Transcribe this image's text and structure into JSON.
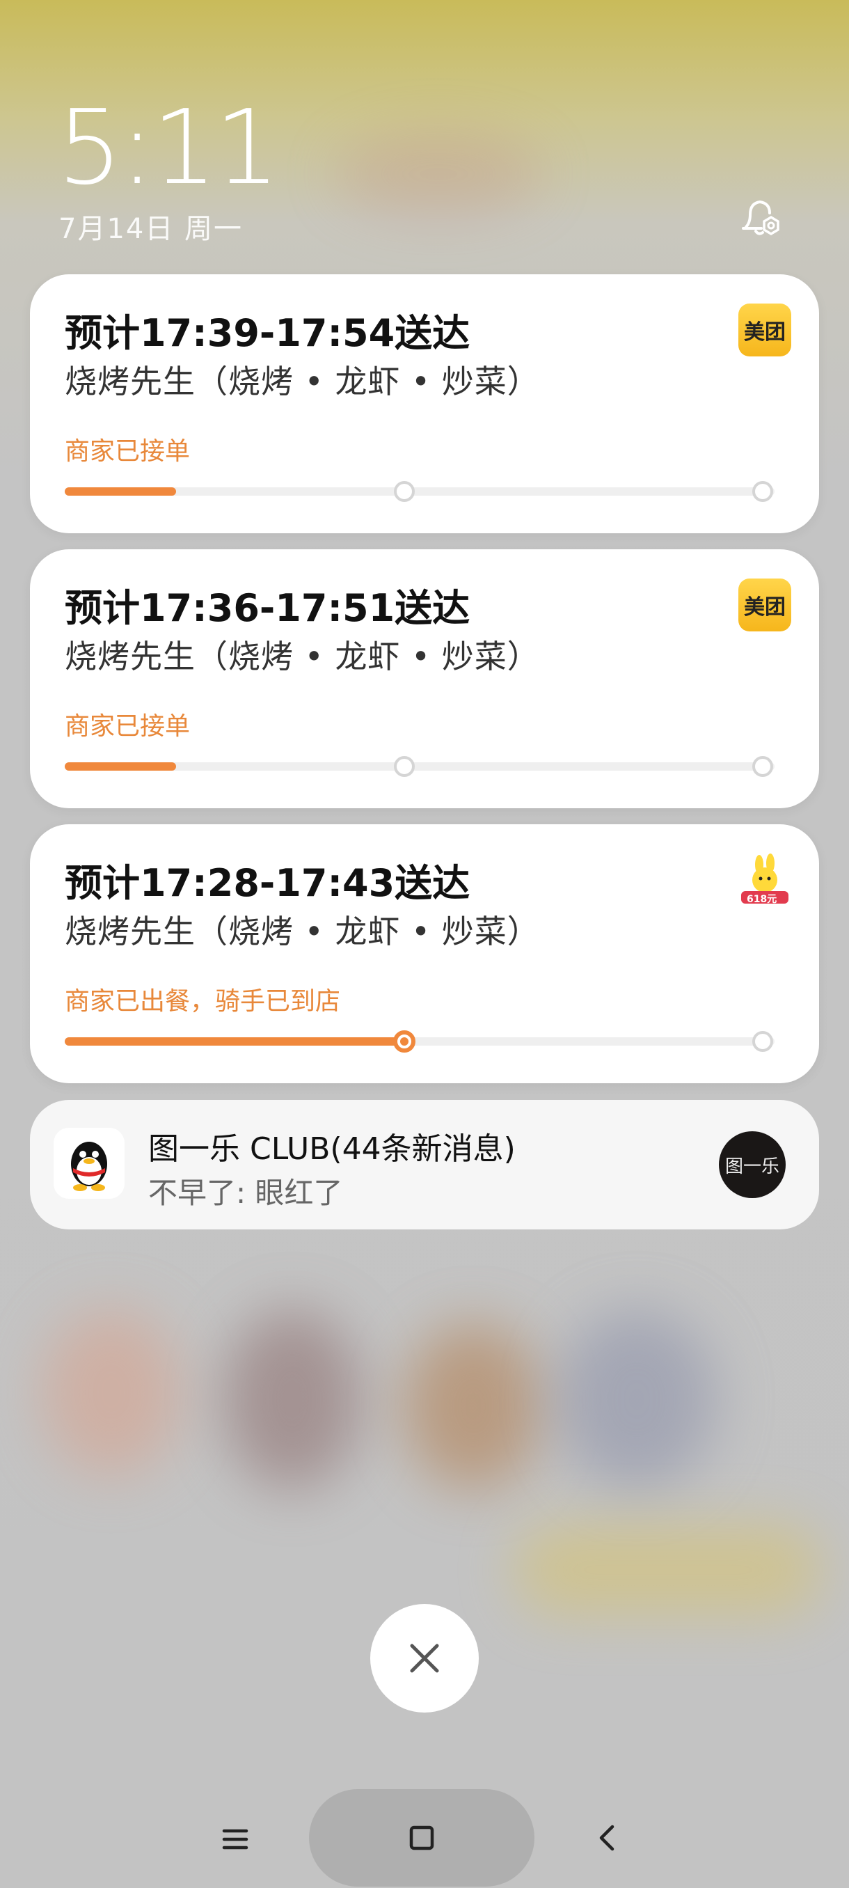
{
  "lockscreen": {
    "time": "5:11",
    "date": "7月14日 周一"
  },
  "notifications": [
    {
      "title": "预计17:39-17:54送达",
      "store": "烧烤先生（烧烤 • 龙虾 • 炒菜）",
      "status": "商家已接单",
      "progress": 0.17,
      "app_icon": "美团",
      "app": "meituan"
    },
    {
      "title": "预计17:36-17:51送达",
      "store": "烧烤先生（烧烤 • 龙虾 • 炒菜）",
      "status": "商家已接单",
      "progress": 0.17,
      "app_icon": "美团",
      "app": "meituan"
    },
    {
      "title": "预计17:28-17:43送达",
      "store": "烧烤先生（烧烤 • 龙虾 • 炒菜）",
      "status": "商家已出餐，骑手已到店",
      "progress": 0.5,
      "app_icon": "618元",
      "app": "meituan-618"
    }
  ],
  "qq_notification": {
    "title": "图一乐 CLUB(44条新消息)",
    "message": "不早了: 眼红了",
    "avatar_text": "图一乐",
    "app_icon": "qq-penguin-icon"
  },
  "colors": {
    "accent": "#f0883c",
    "meituan_yellow": "#ffd54a"
  },
  "icons": {
    "bell": "bell-settings-icon",
    "close": "close-icon",
    "menu": "menu-icon",
    "home": "home-square-icon",
    "back": "back-chevron-icon"
  }
}
